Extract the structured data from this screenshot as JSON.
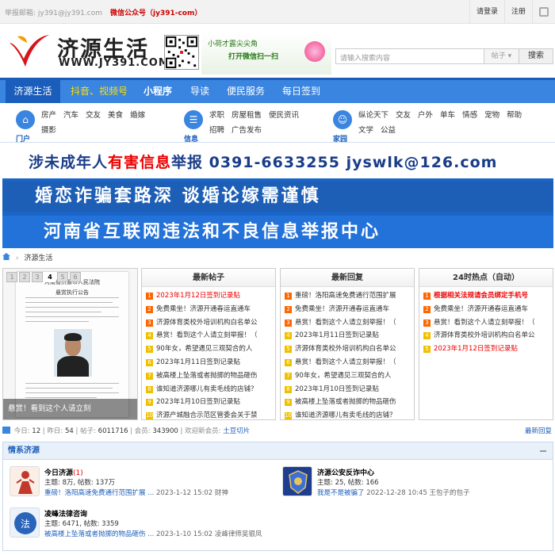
{
  "topbar": {
    "email_label": "举报邮箱: jy391@jy391.com",
    "wechat_label": "微信公众号（jy391-com）",
    "login": "请登录",
    "register": "注册"
  },
  "header": {
    "logo_text": "济源生活",
    "logo_url": "WWW.JY391.COM",
    "wechat_promo_line1": "小荷才露尖尖角",
    "wechat_promo_line2": "打开微信扫一扫",
    "search_placeholder": "请输入搜索内容",
    "search_scope": "帖子",
    "search_button": "搜索"
  },
  "nav": {
    "items": [
      "济源生活",
      "抖音、视频号",
      "小程序",
      "导读",
      "便民服务",
      "每日签到"
    ]
  },
  "subnav": {
    "groups": [
      {
        "label": "门户",
        "links": [
          "房产",
          "汽车",
          "交友",
          "美食",
          "婚嫁",
          "摄影"
        ]
      },
      {
        "label": "信息",
        "links": [
          "求职",
          "房屋租售",
          "便民资讯",
          "招聘",
          "广告发布"
        ]
      },
      {
        "label": "家园",
        "links": [
          "纵论天下",
          "交友",
          "户外",
          "单车",
          "情感",
          "宠物",
          "帮助",
          "文学",
          "公益"
        ]
      }
    ]
  },
  "banner": {
    "line1_a": "涉未成年人",
    "line1_b": "有害信息",
    "line1_c": "举报  0391-6633255  jyswlk@126.com",
    "line2": "婚恋诈骗套路深   谈婚论嫁需谨慎",
    "line3": "河南省互联网违法和不良信息举报中心"
  },
  "breadcrumb": "济源生活",
  "slider": {
    "tabs": [
      "1",
      "2",
      "3",
      "4",
      "5",
      "6"
    ],
    "active_tab": "4",
    "doc_title": "河南省济源市人民法院",
    "doc_subtitle": "悬赏执行公告",
    "caption": "悬赏！看到这个人请立刻"
  },
  "latest_posts": {
    "title": "最新帖子",
    "items": [
      "2023年1月12日签到记录贴",
      "免费乘坐！济源开通春运直通车",
      "济源体育类校外培训机构白名单公",
      "悬赏！看到这个人请立刻举报！（",
      "90年女，希望遇见三观契合的人",
      "2023年1月11日签到记录贴",
      "被高楼上坠落或者抛掷的物品砸伤",
      "谁知道济源哪儿有卖毛线的店铺？",
      "2023年1月10日签到记录贴",
      "济源产城融合示范区管委会关于禁"
    ]
  },
  "latest_replies": {
    "title": "最新回复",
    "items": [
      "重磅！洛阳高速免费通行范围扩展",
      "免费乘坐！济源开通春运直通车",
      "悬赏！看到这个人请立刻举报！（",
      "2023年1月11日签到记录贴",
      "济源体育类校外培训机构白名单公",
      "悬赏！看到这个人请立刻举报！（",
      "90年女，希望遇见三观契合的人",
      "2023年1月10日签到记录贴",
      "被高楼上坠落或者抛掷的物品砸伤",
      "谁知道济源哪儿有卖毛线的店铺？"
    ]
  },
  "hot24": {
    "title": "24时热点（自动）",
    "items": [
      "根据相关法规请会员绑定手机号",
      "免费乘坐！济源开通春运直通车",
      "悬赏！看到这个人请立刻举报！（",
      "济源体育类校外培训机构白名单公",
      "2023年1月12日签到记录贴"
    ]
  },
  "stats": {
    "today_label": "今日:",
    "today": "12",
    "yesterday_label": "昨日:",
    "yesterday": "54",
    "posts_label": "帖子:",
    "posts": "6011716",
    "members_label": "会员:",
    "members": "343900",
    "welcome_label": "欢迎新会员:",
    "newest_member": "土豆切片",
    "latest_reply_link": "最新回复"
  },
  "forum": {
    "section_title": "情系济源",
    "boards": [
      {
        "name": "今日济源",
        "today": "(1)",
        "meta": "主题: 8万, 帖数: 137万",
        "last_title": "重磅！洛阳高速免费通行范围扩展 ...",
        "last_info": "2023-1-12 15:02 财神"
      },
      {
        "name": "济源公安反诈中心",
        "today": "",
        "meta": "主题: 25, 帖数: 166",
        "last_title": "我是不是被骗了",
        "last_info": "2022-12-28 10:45 王包子的包子"
      },
      {
        "name": "凌峰法律咨询",
        "today": "",
        "meta": "主题: 6471, 帖数: 3359",
        "last_title": "被高楼上坠落或者抛掷的物品砸伤 ...",
        "last_info": "2023-1-10 15:02 凌峰律师吴银凤"
      }
    ]
  },
  "colors": {
    "nav_blue": "#3a85e0",
    "nav_dark": "#1b5dbb",
    "hot_yellow": "#ffe000",
    "alert_red": "#e00000"
  }
}
